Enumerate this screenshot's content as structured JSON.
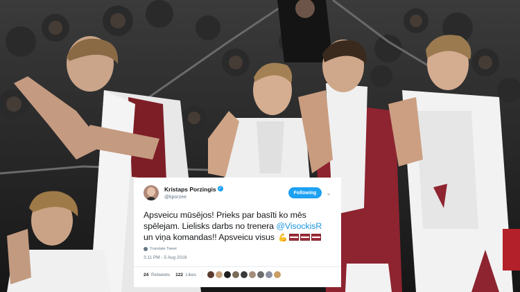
{
  "tweet": {
    "display_name": "Kristaps Porzingis",
    "handle": "@kporzee",
    "follow_label": "Following",
    "text_part1": "Apsveicu mūsējos! Prieks par basīti ko mēs spēlejam. Lielisks darbs no trenera ",
    "mention": "@VisockisR",
    "text_part2": " un viņa komandas!! Apsveicu visus ",
    "translate_label": "Translate Tweet",
    "timestamp": "3:11 PM - 5 Aug 2018",
    "retweets_count": "24",
    "retweets_label": "Retweets",
    "likes_count": "122",
    "likes_label": "Likes"
  },
  "colors": {
    "twitter_blue": "#1da1f2",
    "latvia_carmine": "#9e3039",
    "uniform_white": "#f2f2f2"
  },
  "icons": {
    "verified": "verified-badge-icon",
    "caret": "chevron-down-icon",
    "translate": "globe-icon",
    "emoji": "flexed-biceps-emoji",
    "flags": "latvia-flag-emoji"
  },
  "liker_avatar_colors": [
    "#5a3b2e",
    "#c6a27d",
    "#1f1f1f",
    "#7b6a58",
    "#3a3a3a",
    "#a38d7a",
    "#6d6d6d",
    "#8c8fa0",
    "#c89e64"
  ]
}
